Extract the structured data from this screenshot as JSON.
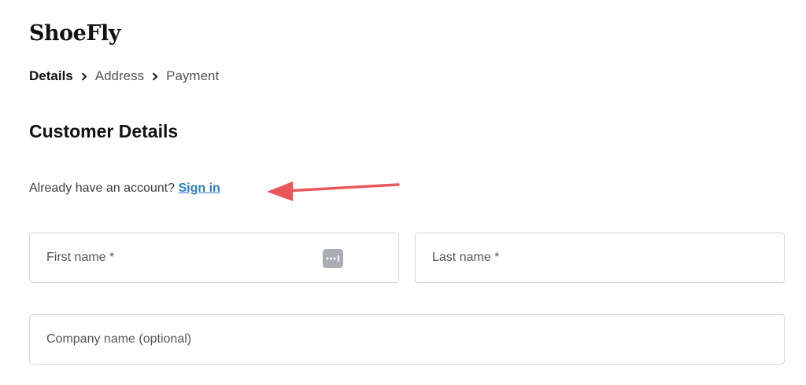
{
  "brand": {
    "logo_text": "ShoeFly"
  },
  "breadcrumb": {
    "steps": [
      {
        "label": "Details",
        "active": true
      },
      {
        "label": "Address",
        "active": false
      },
      {
        "label": "Payment",
        "active": false
      }
    ],
    "separator_icon": "chevron-right-icon"
  },
  "page": {
    "title": "Customer Details"
  },
  "account": {
    "prompt": "Already have an account?",
    "signin_label": "Sign in"
  },
  "annotation": {
    "icon": "arrow-left-icon",
    "color": "#e8585b"
  },
  "form": {
    "first_name": {
      "placeholder": "First name *",
      "value": "",
      "autofill_icon": "password-dots-icon"
    },
    "last_name": {
      "placeholder": "Last name *",
      "value": ""
    },
    "company_name": {
      "placeholder": "Company name (optional)",
      "value": ""
    }
  },
  "colors": {
    "link": "#2f7fc4",
    "border": "#d6d6d6",
    "text": "#3c3c3c",
    "heading": "#111111"
  }
}
